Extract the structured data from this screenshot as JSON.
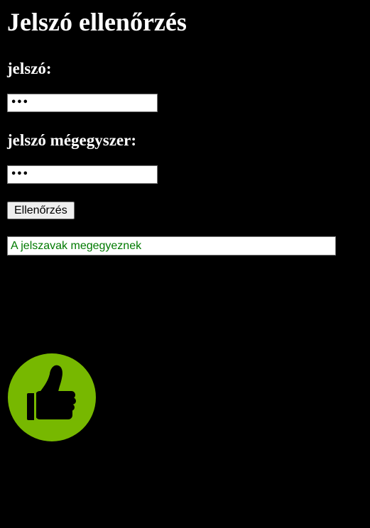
{
  "page": {
    "title": "Jelszó ellenőrzés"
  },
  "form": {
    "password_label": "jelszó:",
    "password_value": "•••",
    "confirm_label": "jelszó mégegyszer:",
    "confirm_value": "•••",
    "check_button_label": "Ellenőrzés"
  },
  "result": {
    "message": "A jelszavak megegyeznek",
    "message_color": "#007a00"
  },
  "status_icon": {
    "name": "thumbs-up-icon",
    "background_color": "#77b800",
    "glyph_color": "#000000"
  },
  "colors": {
    "page_background": "#000000",
    "text": "#ffffff"
  }
}
